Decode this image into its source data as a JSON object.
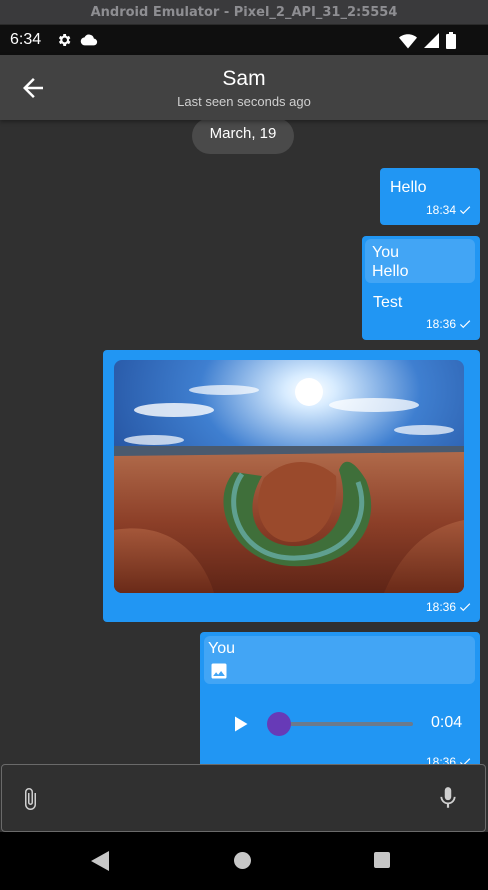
{
  "emulator": {
    "title": "Android Emulator - Pixel_2_API_31_2:5554"
  },
  "status_bar": {
    "time": "6:34",
    "left_icons": [
      "settings-gear-icon",
      "cloud-icon"
    ],
    "right_icons": [
      "wifi-icon",
      "cellular-signal-icon",
      "battery-icon"
    ]
  },
  "app_bar": {
    "back_icon": "arrow-back-icon",
    "title": "Sam",
    "subtitle": "Last seen seconds ago"
  },
  "chat": {
    "date_separator": "March, 19",
    "messages": [
      {
        "type": "text",
        "text": "Hello",
        "time": "18:34",
        "status_icon": "check-icon"
      },
      {
        "type": "reply",
        "reply_to_name": "You",
        "reply_to_text": "Hello",
        "text": "Test",
        "time": "18:36",
        "status_icon": "check-icon"
      },
      {
        "type": "image",
        "image": "canyon-river-bend-photo",
        "time": "18:36",
        "status_icon": "check-icon"
      },
      {
        "type": "audio",
        "reply_to_name": "You",
        "reply_to_icon": "image-icon",
        "duration": "0:04",
        "progress": 0.0,
        "time": "18:36",
        "status_icon": "check-icon"
      }
    ]
  },
  "input_bar": {
    "attach_icon": "paperclip-icon",
    "mic_icon": "microphone-icon"
  },
  "nav_bar": {
    "icons": [
      "nav-back-triangle-icon",
      "nav-home-circle-icon",
      "nav-recents-square-icon"
    ]
  },
  "colors": {
    "background": "#303030",
    "app_bar": "#424242",
    "bubble": "#2196f3",
    "reply_box": "#42a5f5",
    "slider_thumb": "#673ab7"
  }
}
